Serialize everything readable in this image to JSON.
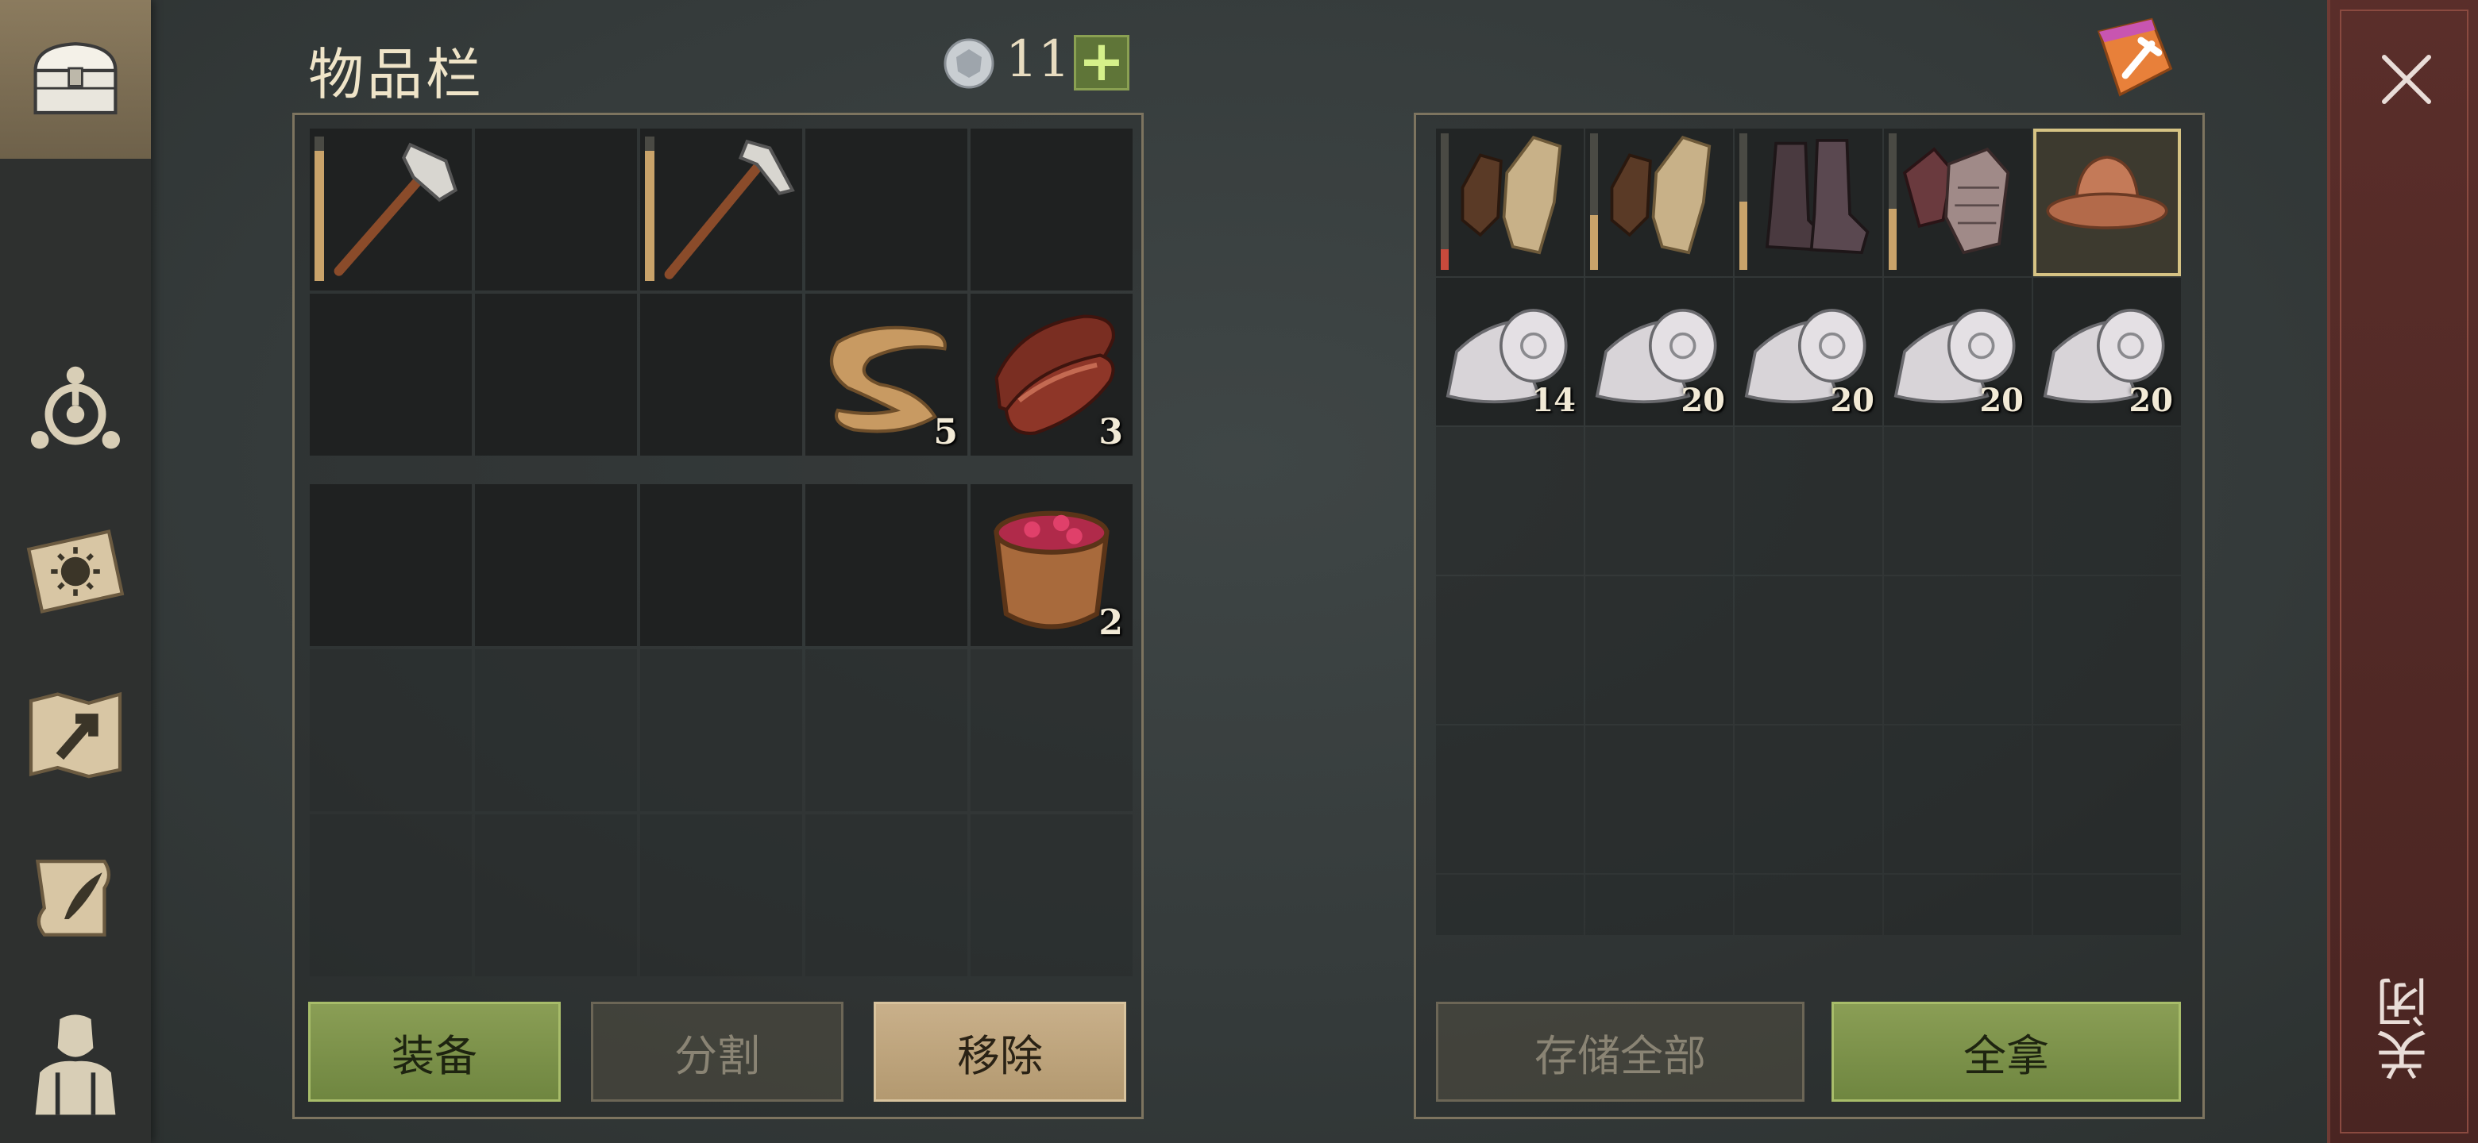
{
  "sidebar": {
    "items": [
      {
        "name": "chest",
        "icon": "chest-icon",
        "active": true
      },
      {
        "name": "skills",
        "icon": "compass-icon",
        "active": false
      },
      {
        "name": "events",
        "icon": "sun-book-icon",
        "active": false
      },
      {
        "name": "map",
        "icon": "map-arrow-icon",
        "active": false
      },
      {
        "name": "recipes",
        "icon": "scroll-quill-icon",
        "active": false
      },
      {
        "name": "character",
        "icon": "character-silhouette-icon",
        "active": false
      }
    ]
  },
  "header": {
    "title": "物品栏",
    "currency_count": "11",
    "add_label": "+"
  },
  "inventory": {
    "slots": [
      {
        "item": "stone-hatchet-icon",
        "qty": "",
        "durability": 0.9
      },
      {
        "item": "",
        "qty": ""
      },
      {
        "item": "stone-pickaxe-icon",
        "qty": "",
        "durability": 0.9
      },
      {
        "item": "",
        "qty": ""
      },
      {
        "item": "",
        "qty": ""
      },
      {
        "item": "",
        "qty": ""
      },
      {
        "item": "",
        "qty": ""
      },
      {
        "item": "",
        "qty": ""
      },
      {
        "item": "rope-icon",
        "qty": "5"
      },
      {
        "item": "raw-meat-icon",
        "qty": "3"
      }
    ],
    "pocket_slots": [
      {
        "item": "",
        "qty": ""
      },
      {
        "item": "",
        "qty": ""
      },
      {
        "item": "",
        "qty": ""
      },
      {
        "item": "",
        "qty": ""
      },
      {
        "item": "berry-bowl-icon",
        "qty": "2"
      }
    ],
    "buttons": {
      "equip": "装备",
      "split": "分割",
      "remove": "移除"
    }
  },
  "container": {
    "sort_icon": "sort-broom-icon",
    "cells": [
      {
        "item": "leather-gloves-icon",
        "qty": "",
        "durability": 0.15,
        "dur_color": "#c84a3c"
      },
      {
        "item": "leather-gloves-icon",
        "qty": "",
        "durability": 0.4,
        "dur_color": "#c9a36a"
      },
      {
        "item": "leather-boots-icon",
        "qty": "",
        "durability": 0.5,
        "dur_color": "#c9a36a"
      },
      {
        "item": "chainmail-gloves-icon",
        "qty": "",
        "durability": 0.45,
        "dur_color": "#c9a36a"
      },
      {
        "item": "copper-helmet-icon",
        "qty": "",
        "selected": true
      },
      {
        "item": "cloth-roll-icon",
        "qty": "14"
      },
      {
        "item": "cloth-roll-icon",
        "qty": "20"
      },
      {
        "item": "cloth-roll-icon",
        "qty": "20"
      },
      {
        "item": "cloth-roll-icon",
        "qty": "20"
      },
      {
        "item": "cloth-roll-icon",
        "qty": "20"
      }
    ],
    "buttons": {
      "store_all": "存储全部",
      "take_all": "全拿"
    }
  },
  "close": {
    "label": "关闭"
  },
  "colors": {
    "green_button": "#7a9148",
    "tan_button": "#c2a87f",
    "close_bar": "#52292a",
    "durability_bar": "#c9a36a"
  }
}
